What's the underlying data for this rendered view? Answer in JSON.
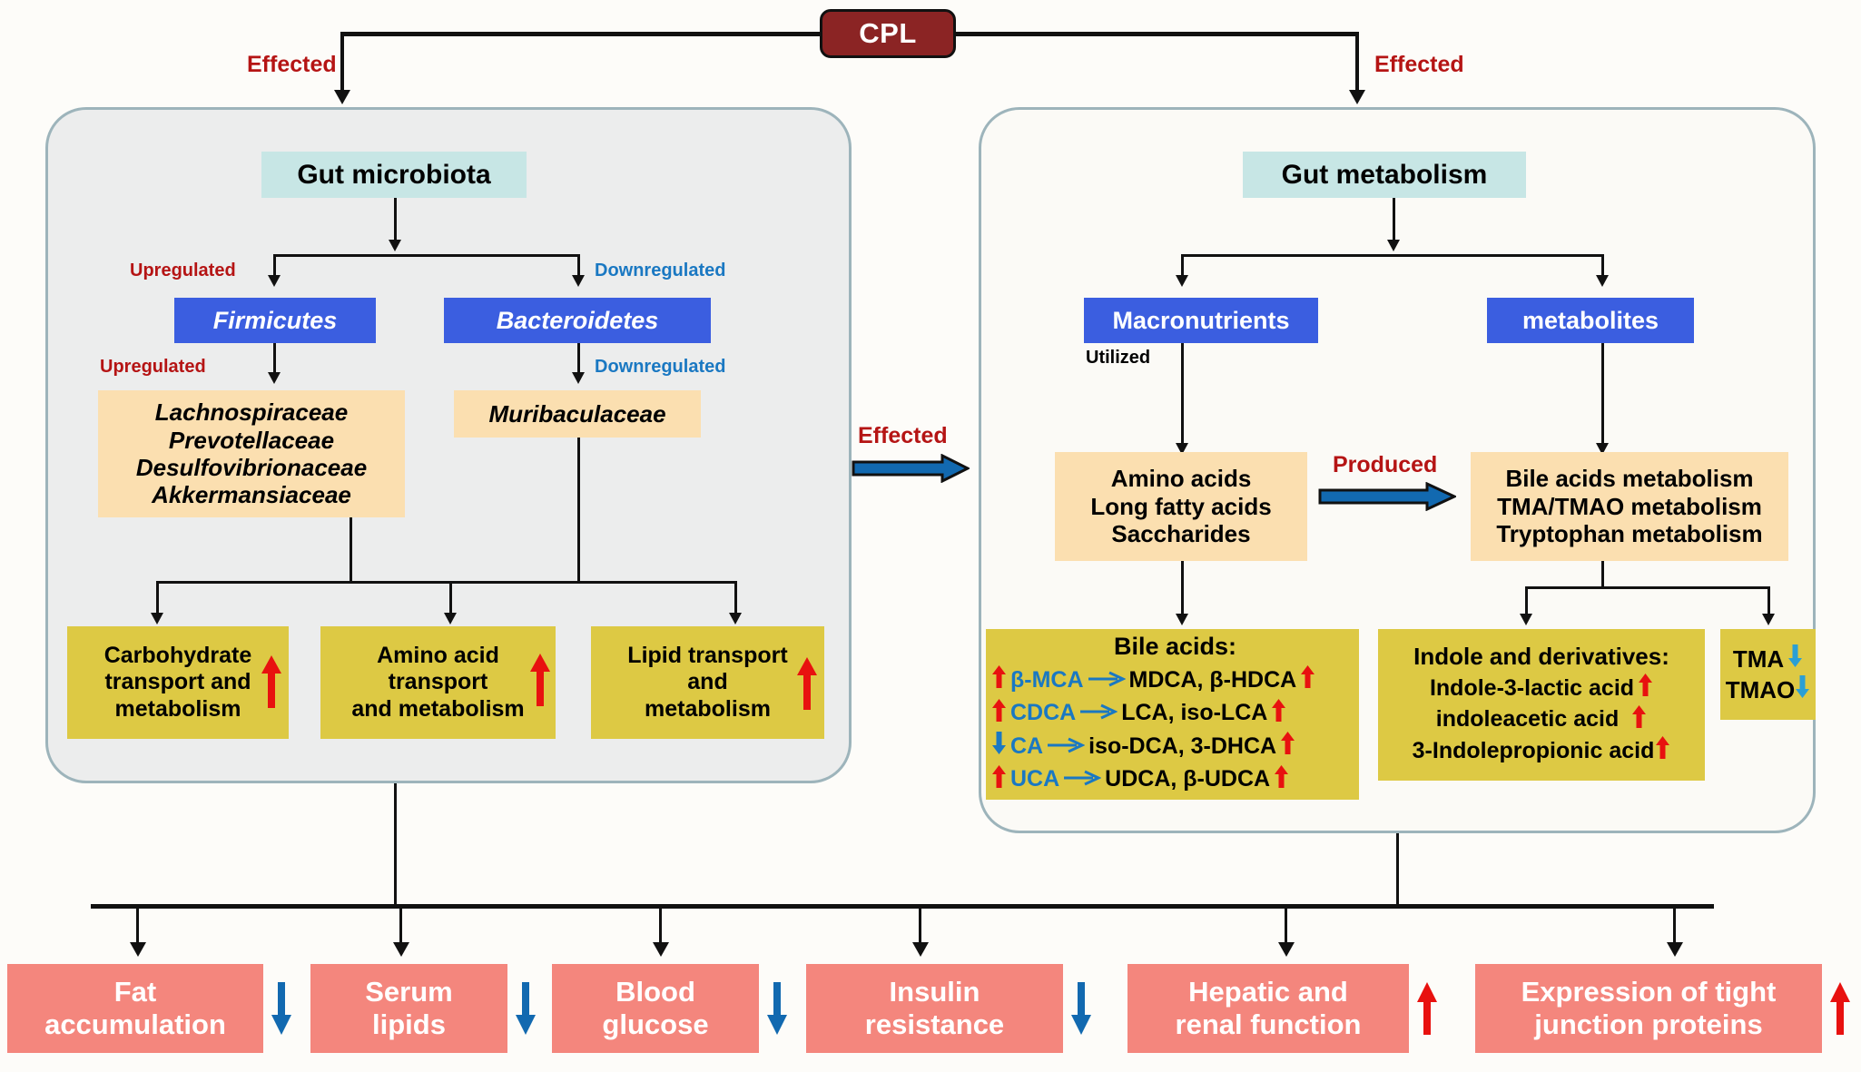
{
  "root": {
    "label": "CPL"
  },
  "edge_labels": {
    "effected_left": "Effected",
    "effected_right": "Effected",
    "effected_mid": "Effected",
    "produced": "Produced",
    "upregulated_1": "Upregulated",
    "upregulated_2": "Upregulated",
    "downregulated_1": "Downregulated",
    "downregulated_2": "Downregulated",
    "utilized": "Utilized"
  },
  "left_panel": {
    "title": "Gut microbiota",
    "phyla": [
      {
        "name": "Firmicutes"
      },
      {
        "name": "Bacteroidetes"
      }
    ],
    "families_up": [
      "Lachnospiraceae",
      "Prevotellaceae",
      "Desulfovibrionaceae",
      "Akkermansiaceae"
    ],
    "families_down": [
      "Muribaculaceae"
    ],
    "functions": [
      {
        "lines": [
          "Carbohydrate",
          "transport and",
          "metabolism"
        ],
        "trend": "up"
      },
      {
        "lines": [
          "Amino acid",
          "transport",
          "and metabolism"
        ],
        "trend": "up"
      },
      {
        "lines": [
          "Lipid transport",
          "and",
          "metabolism"
        ],
        "trend": "up"
      }
    ]
  },
  "right_panel": {
    "title": "Gut metabolism",
    "branches": [
      {
        "name": "Macronutrients"
      },
      {
        "name": "metabolites"
      }
    ],
    "macronutrient_items": [
      "Amino acids",
      "Long fatty acids",
      "Saccharides"
    ],
    "metabolite_items": [
      "Bile acids metabolism",
      "TMA/TMAO metabolism",
      "Tryptophan metabolism"
    ],
    "bile_acids": {
      "heading": "Bile acids:",
      "rows": [
        {
          "substrate_trend": "up",
          "substrate": "β-MCA",
          "products": "MDCA, β-HDCA",
          "product_trend": "up"
        },
        {
          "substrate_trend": "up",
          "substrate": "CDCA",
          "products": "LCA, iso-LCA",
          "product_trend": "up"
        },
        {
          "substrate_trend": "down",
          "substrate": "CA",
          "products": "iso-DCA, 3-DHCA",
          "product_trend": "up"
        },
        {
          "substrate_trend": "up",
          "substrate": "UCA",
          "products": "UDCA,  β-UDCA",
          "product_trend": "up"
        }
      ]
    },
    "indoles": {
      "heading": "Indole and derivatives:",
      "rows": [
        {
          "name": "Indole-3-lactic acid",
          "trend": "up"
        },
        {
          "name": "indoleacetic acid",
          "trend": "up"
        },
        {
          "name": "3-Indolepropionic acid",
          "trend": "up"
        }
      ]
    },
    "tma": {
      "rows": [
        {
          "name": "TMA",
          "trend": "down"
        },
        {
          "name": "TMAO",
          "trend": "down"
        }
      ]
    }
  },
  "outcomes": [
    {
      "lines": [
        "Fat",
        "accumulation"
      ],
      "trend": "down"
    },
    {
      "lines": [
        "Serum",
        "lipids"
      ],
      "trend": "down"
    },
    {
      "lines": [
        "Blood",
        "glucose"
      ],
      "trend": "down"
    },
    {
      "lines": [
        "Insulin",
        "resistance"
      ],
      "trend": "down"
    },
    {
      "lines": [
        "Hepatic and",
        "renal function"
      ],
      "trend": "up"
    },
    {
      "lines": [
        "Expression of tight",
        "junction proteins"
      ],
      "trend": "up"
    }
  ],
  "colors": {
    "cpl": "#8b2424",
    "teal": "#c7e6e5",
    "blue": "#3b5ee0",
    "peach": "#fbdfb0",
    "yellow": "#ddc944",
    "salmon": "#f4867d",
    "up_arrow": "#e8110f",
    "down_arrow": "#1a78c2",
    "label_red": "#b51414",
    "label_blue": "#1a78c2"
  }
}
